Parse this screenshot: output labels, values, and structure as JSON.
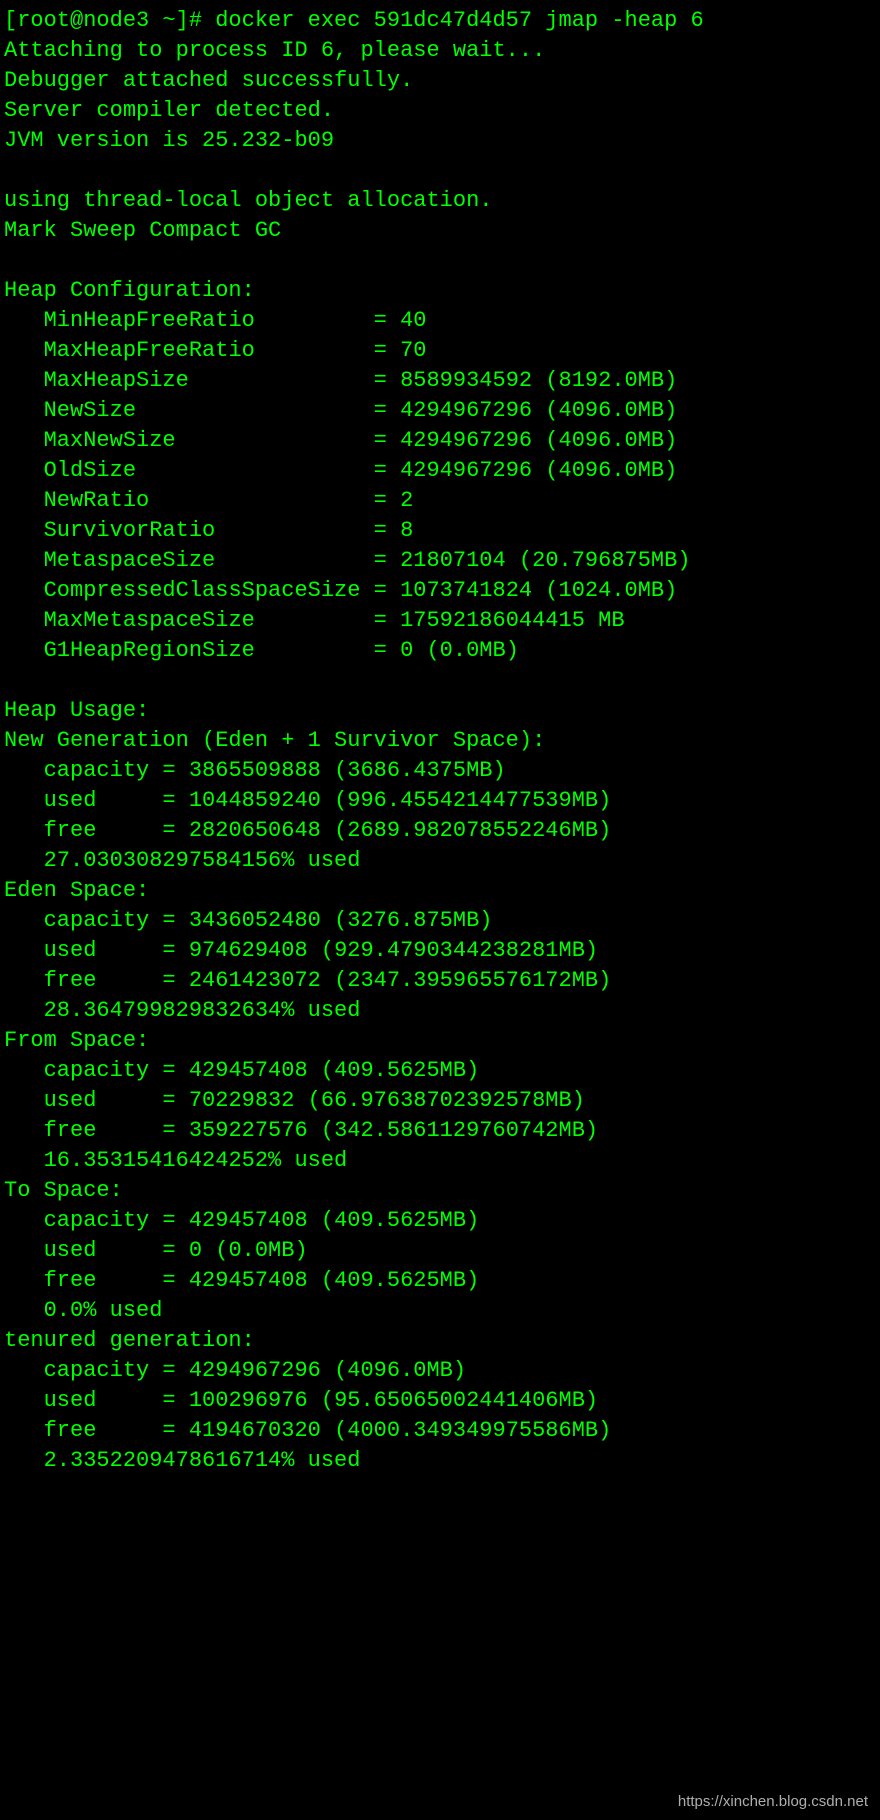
{
  "prompt": "[root@node3 ~]# docker exec 591dc47d4d57 jmap -heap 6",
  "attach_line": "Attaching to process ID 6, please wait...",
  "debugger_line": "Debugger attached successfully.",
  "compiler_line": "Server compiler detected.",
  "jvm_line": "JVM version is 25.232-b09",
  "alloc_line": "using thread-local object allocation.",
  "gc_line": "Mark Sweep Compact GC",
  "heap_config_header": "Heap Configuration:",
  "heap_config": {
    "MinHeapFreeRatio": {
      "label": "MinHeapFreeRatio",
      "value": "40"
    },
    "MaxHeapFreeRatio": {
      "label": "MaxHeapFreeRatio",
      "value": "70"
    },
    "MaxHeapSize": {
      "label": "MaxHeapSize",
      "value": "8589934592 (8192.0MB)"
    },
    "NewSize": {
      "label": "NewSize",
      "value": "4294967296 (4096.0MB)"
    },
    "MaxNewSize": {
      "label": "MaxNewSize",
      "value": "4294967296 (4096.0MB)"
    },
    "OldSize": {
      "label": "OldSize",
      "value": "4294967296 (4096.0MB)"
    },
    "NewRatio": {
      "label": "NewRatio",
      "value": "2"
    },
    "SurvivorRatio": {
      "label": "SurvivorRatio",
      "value": "8"
    },
    "MetaspaceSize": {
      "label": "MetaspaceSize",
      "value": "21807104 (20.796875MB)"
    },
    "CompressedClassSpaceSize": {
      "label": "CompressedClassSpaceSize",
      "value": "1073741824 (1024.0MB)"
    },
    "MaxMetaspaceSize": {
      "label": "MaxMetaspaceSize",
      "value": "17592186044415 MB"
    },
    "G1HeapRegionSize": {
      "label": "G1HeapRegionSize",
      "value": "0 (0.0MB)"
    }
  },
  "heap_usage_header": "Heap Usage:",
  "sections": {
    "newgen": {
      "title": "New Generation (Eden + 1 Survivor Space):",
      "capacity": "3865509888 (3686.4375MB)",
      "used": "1044859240 (996.4554214477539MB)",
      "free": "2820650648 (2689.982078552246MB)",
      "pct": "27.030308297584156% used"
    },
    "eden": {
      "title": "Eden Space:",
      "capacity": "3436052480 (3276.875MB)",
      "used": "974629408 (929.4790344238281MB)",
      "free": "2461423072 (2347.395965576172MB)",
      "pct": "28.364799829832634% used"
    },
    "from": {
      "title": "From Space:",
      "capacity": "429457408 (409.5625MB)",
      "used": "70229832 (66.97638702392578MB)",
      "free": "359227576 (342.5861129760742MB)",
      "pct": "16.35315416424252% used"
    },
    "to": {
      "title": "To Space:",
      "capacity": "429457408 (409.5625MB)",
      "used": "0 (0.0MB)",
      "free": "429457408 (409.5625MB)",
      "pct": "0.0% used"
    },
    "tenured": {
      "title": "tenured generation:",
      "capacity": "4294967296 (4096.0MB)",
      "used": "100296976 (95.65065002441406MB)",
      "free": "4194670320 (4000.349349975586MB)",
      "pct": "2.3352209478616714% used"
    }
  },
  "labels": {
    "capacity": "capacity",
    "used": "used",
    "free": "free"
  },
  "watermark": "https://xinchen.blog.csdn.net"
}
